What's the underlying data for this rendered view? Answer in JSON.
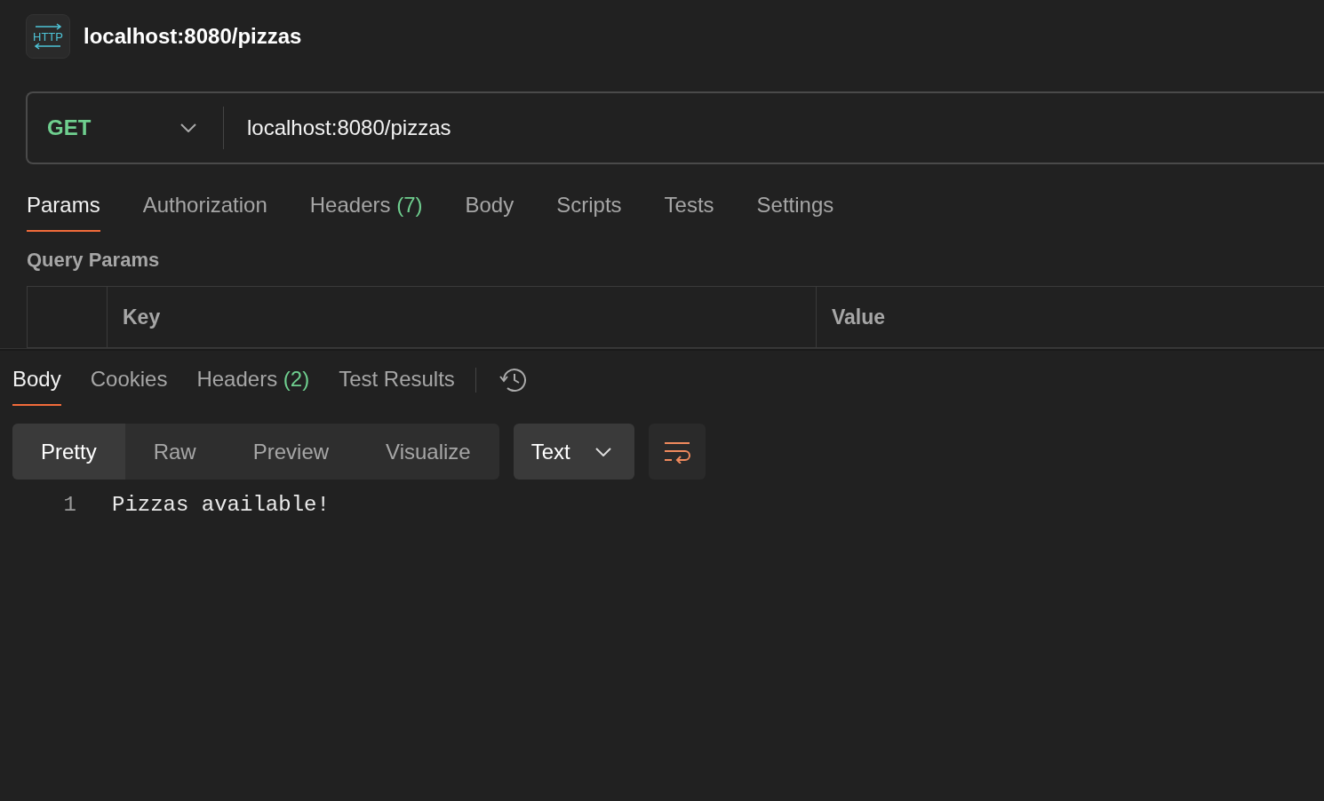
{
  "header": {
    "icon_text": "HTTP",
    "title": "localhost:8080/pizzas"
  },
  "request": {
    "method": "GET",
    "url": "localhost:8080/pizzas"
  },
  "request_tabs": [
    {
      "label": "Params",
      "selected": true
    },
    {
      "label": "Authorization",
      "selected": false
    },
    {
      "label": "Headers",
      "count": "(7)",
      "selected": false
    },
    {
      "label": "Body",
      "selected": false
    },
    {
      "label": "Scripts",
      "selected": false
    },
    {
      "label": "Tests",
      "selected": false
    },
    {
      "label": "Settings",
      "selected": false
    }
  ],
  "query_params": {
    "title": "Query Params",
    "columns": [
      "Key",
      "Value"
    ]
  },
  "response_tabs": [
    {
      "label": "Body",
      "selected": true
    },
    {
      "label": "Cookies",
      "selected": false
    },
    {
      "label": "Headers",
      "count": "(2)",
      "selected": false
    },
    {
      "label": "Test Results",
      "selected": false
    }
  ],
  "view_modes": [
    {
      "label": "Pretty",
      "selected": true
    },
    {
      "label": "Raw",
      "selected": false
    },
    {
      "label": "Preview",
      "selected": false
    },
    {
      "label": "Visualize",
      "selected": false
    }
  ],
  "format": "Text",
  "code_lines": [
    {
      "number": "1",
      "text": "Pizzas available!"
    }
  ]
}
